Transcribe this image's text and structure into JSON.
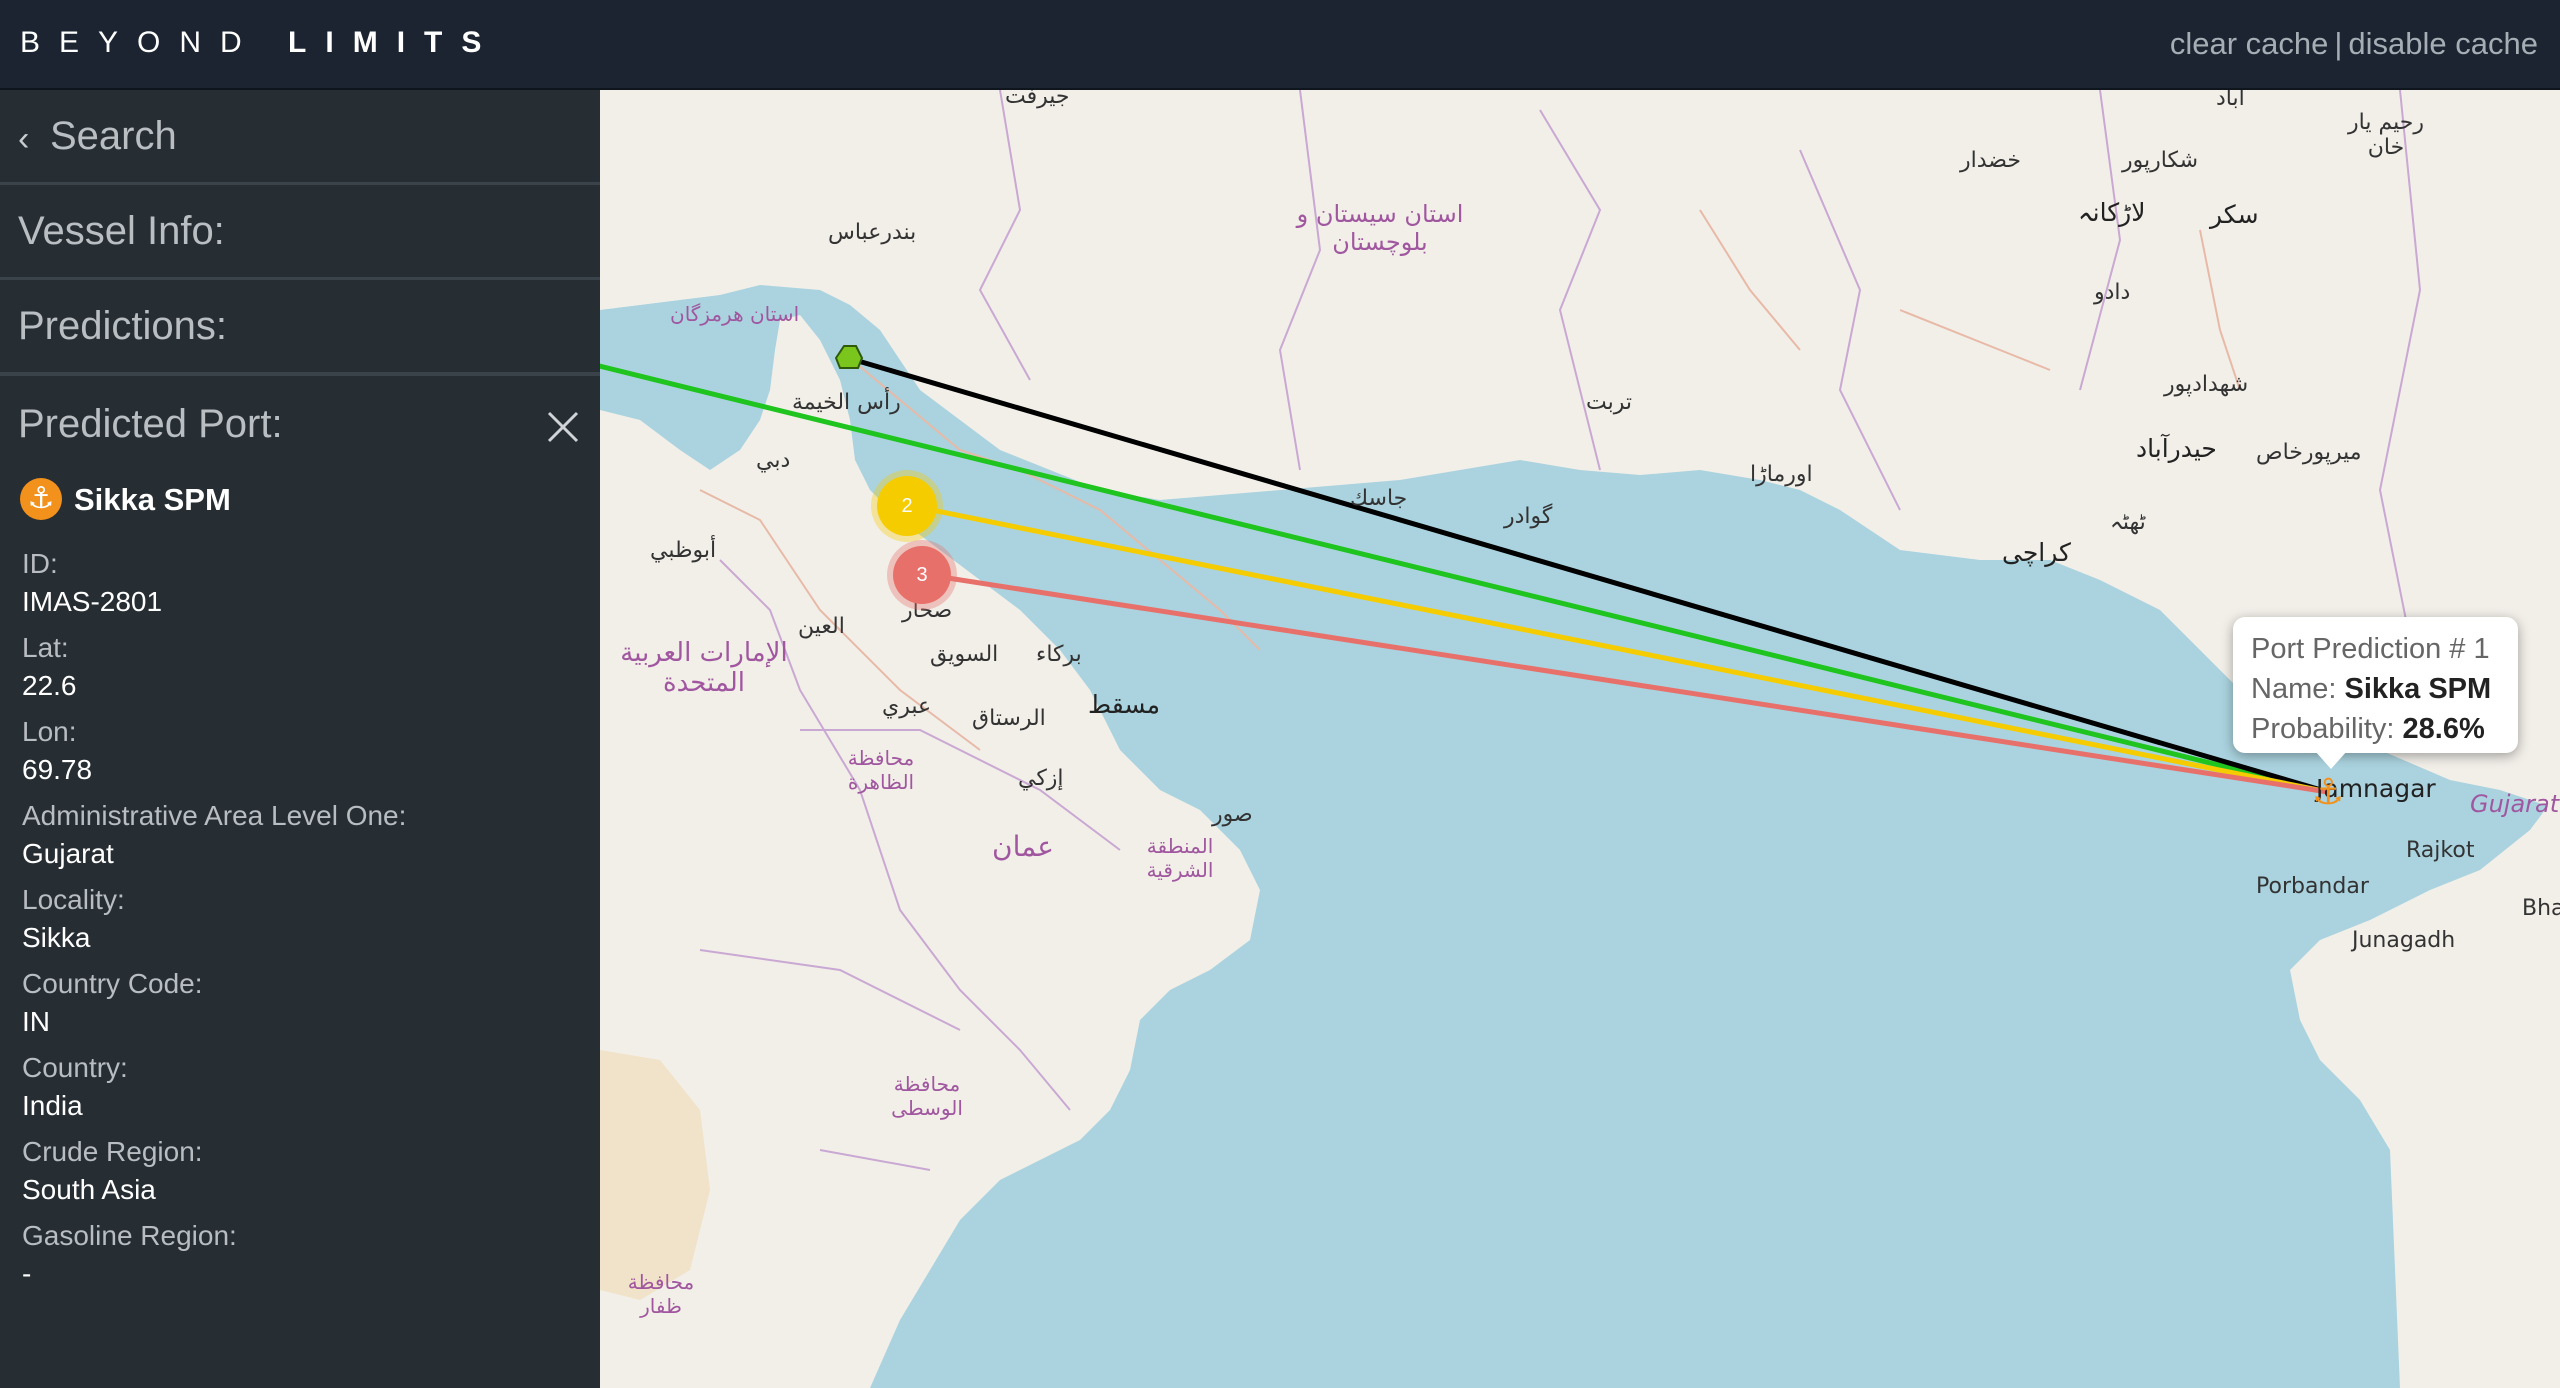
{
  "header": {
    "brand_first": "BEYOND",
    "brand_second": "LIMITS",
    "clear_cache": "clear cache",
    "separator": "|",
    "disable_cache": "disable cache"
  },
  "sidebar": {
    "search_label": "Search",
    "vessel_info_label": "Vessel Info:",
    "predictions_label": "Predictions:",
    "predicted_port_label": "Predicted Port:",
    "port_name": "Sikka SPM",
    "fields": [
      {
        "key": "ID:",
        "value": "IMAS-2801"
      },
      {
        "key": "Lat:",
        "value": "22.6"
      },
      {
        "key": "Lon:",
        "value": "69.78"
      },
      {
        "key": "Administrative Area Level One:",
        "value": "Gujarat"
      },
      {
        "key": "Locality:",
        "value": "Sikka"
      },
      {
        "key": "Country Code:",
        "value": "IN"
      },
      {
        "key": "Country:",
        "value": "India"
      },
      {
        "key": "Crude Region:",
        "value": "South Asia"
      },
      {
        "key": "Gasoline Region:",
        "value": "-"
      }
    ]
  },
  "popup": {
    "title": "Port Prediction # 1",
    "name_label": "Name:",
    "name_value": "Sikka SPM",
    "prob_label": "Probability:",
    "prob_value": "28.6%"
  },
  "markers": {
    "second": "2",
    "third": "3"
  },
  "map_labels": {
    "jiroft": "جیرفت",
    "bandar_abbas": "بندرعباس",
    "hormozgan": "استان هرمزگان",
    "ras_khaimah": "رأس الخيمة",
    "dubai": "دبي",
    "abudhabi": "أبوظبي",
    "uae": "الإمارات العربية المتحدة",
    "alain": "العين",
    "sohar": "صحار",
    "suwayq": "السويق",
    "barka": "بركاء",
    "muscat": "مسقط",
    "ibri": "عبري",
    "rustaq": "الرستاق",
    "dhahirah": "محافظة الظاهرة",
    "izki": "إزكي",
    "oman": "عمان",
    "sharqiyah": "المنطقة الشرقية",
    "sur": "صور",
    "wusta": "محافظة الوسطى",
    "dhofar": "محافظة ظفار",
    "sistan": "استان سیستان و بلوچستان",
    "turbat": "تربت",
    "gwadar": "گوادر",
    "ormara": "اورماڑا",
    "jask": "جاسك",
    "karachi": "کراچی",
    "thatta": "ٹھٹہ",
    "hyderabad": "حیدرآباد",
    "mirpur": "میرپورخاص",
    "shahdadpur": "شهدادپور",
    "dadu": "دادو",
    "larkana": "لاڑکانہ",
    "sukkur": "سکر",
    "shikarpur": "شکارپور",
    "khuzdar": "خضدار",
    "abad": "آباد",
    "rahim": "رحیم یار خان",
    "jamnagar": "Jamnagar",
    "gujarat": "Gujarat",
    "rajkot": "Rajkot",
    "porbandar": "Porbandar",
    "junagadh": "Junagadh",
    "bha": "Bha"
  },
  "colors": {
    "topbar": "#1b2430",
    "sidebar": "#262d33",
    "sea": "#aad3df",
    "land": "#f2efe9",
    "route_black": "#000000",
    "route_green": "#1fc41f",
    "route_yellow": "#f5cc00",
    "route_red": "#e8706a",
    "anchor": "#f2911b"
  }
}
